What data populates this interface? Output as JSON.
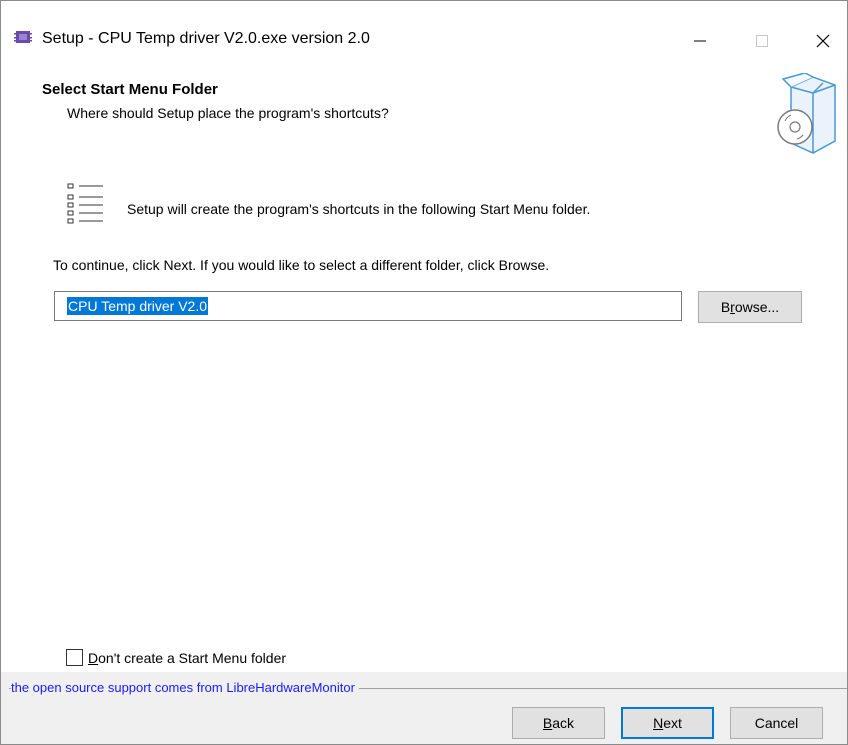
{
  "window": {
    "title": "Setup - CPU Temp driver V2.0.exe version 2.0",
    "controls": {
      "minimize": "minimize-icon",
      "maximize": "maximize-icon",
      "close": "close-icon"
    }
  },
  "header": {
    "title": "Select Start Menu Folder",
    "subtitle": "Where should Setup place the program's shortcuts?"
  },
  "body": {
    "info": "Setup will create the program's shortcuts in the following Start Menu folder.",
    "continue": "To continue, click Next. If you would like to select a different folder, click Browse.",
    "folder_value": "CPU Temp driver V2.0",
    "browse_button": {
      "pre": "B",
      "accel": "r",
      "post": "owse..."
    },
    "no_folder_checkbox": {
      "checked": false,
      "accel": "D",
      "post": "on't create a Start Menu folder"
    }
  },
  "status": {
    "text": "the open source support comes from LibreHardwareMonitor"
  },
  "buttons": {
    "back": {
      "accel": "B",
      "post": "ack"
    },
    "next": {
      "accel": "N",
      "post": "ext"
    },
    "cancel": "Cancel"
  },
  "colors": {
    "accent": "#0078d7",
    "status_text": "#1a1aff",
    "button_bg": "#e1e1e1"
  }
}
